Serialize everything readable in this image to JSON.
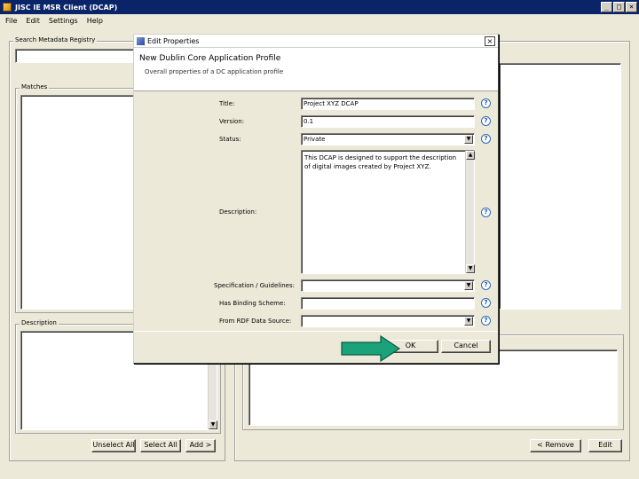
{
  "window": {
    "title": "JISC IE MSR Client (DCAP)",
    "controls": {
      "minimize": "_",
      "maximize": "□",
      "close": "×"
    }
  },
  "menu": [
    "File",
    "Edit",
    "Settings",
    "Help"
  ],
  "left": {
    "search_label": "Search Metadata Registry",
    "search_value": "",
    "matches_label": "Matches",
    "description_label": "Description",
    "buttons": {
      "unselect_all": "Unselect All",
      "select_all": "Select All",
      "add": "Add >"
    }
  },
  "right": {
    "buttons": {
      "remove": "< Remove",
      "edit": "Edit"
    }
  },
  "dialog": {
    "title": "Edit Properties",
    "close": "×",
    "heading": "New Dublin Core Application Profile",
    "subheading": "Overall properties of a DC application profile",
    "fields": {
      "title": {
        "label": "Title:",
        "value": "Project XYZ DCAP"
      },
      "version": {
        "label": "Version:",
        "value": "0.1"
      },
      "status": {
        "label": "Status:",
        "value": "Private"
      },
      "description": {
        "label": "Description:",
        "value": "This DCAP is designed to support the description of digital images created by Project XYZ."
      },
      "specification": {
        "label": "Specification / Guidelines:",
        "value": ""
      },
      "encoding": {
        "label": "Has Binding Scheme:",
        "value": ""
      },
      "rdf_source": {
        "label": "From RDF Data Source:",
        "value": ""
      }
    },
    "help_glyph": "?",
    "ok": "OK",
    "cancel": "Cancel"
  },
  "colors": {
    "titlebar": "#0a246a",
    "window_bg": "#ece9d8",
    "arrow_fill": "#1aa37a",
    "help_blue": "#2a6bc2"
  },
  "icons": {
    "arrow": "green-pointer-arrow",
    "help": "question-circle"
  }
}
